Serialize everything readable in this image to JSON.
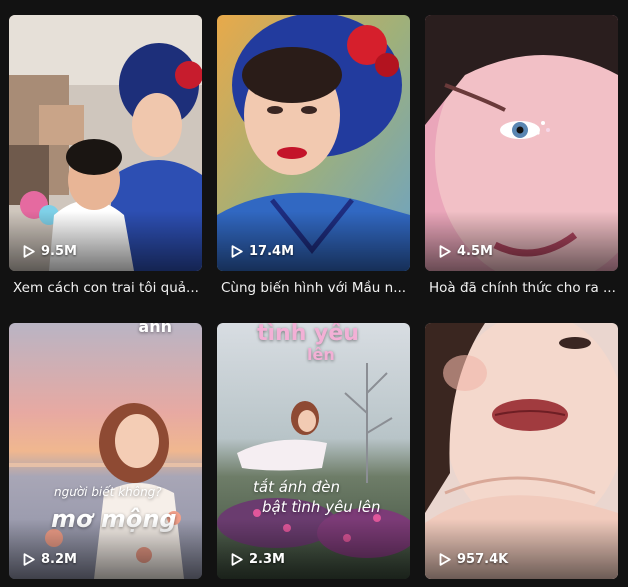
{
  "videos": [
    {
      "views": "9.5M",
      "caption": "Xem cách con trai tôi quả..."
    },
    {
      "views": "17.4M",
      "caption": "Cùng biến hình với Mầu n..."
    },
    {
      "views": "4.5M",
      "caption": "Hoà đã chính thức cho ra ..."
    },
    {
      "views": "8.2M",
      "caption": ""
    },
    {
      "views": "2.3M",
      "caption": ""
    },
    {
      "views": "957.4K",
      "caption": ""
    }
  ],
  "overlay_text": {
    "card4_top": "anh",
    "card4_question": "người biết không?",
    "card4_title": "mơ mộng",
    "card5_title_top": "tình yêu",
    "card5_title_bottom": "lên",
    "card5_line1": "tắt ánh đèn",
    "card5_line2": "bật tình yêu lên"
  },
  "icons": {
    "views": "play-outline-icon"
  },
  "colors": {
    "background": "#121212",
    "text": "#ffffff",
    "caption": "#f1f1f1"
  }
}
